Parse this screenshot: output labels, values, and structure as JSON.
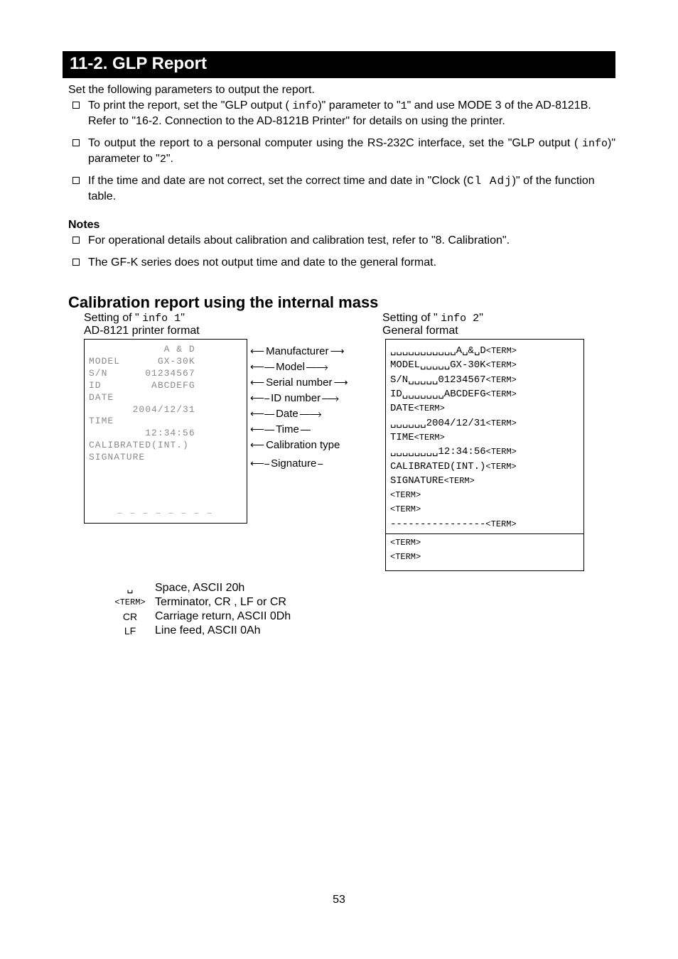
{
  "section": {
    "title": "11-2. GLP Report"
  },
  "intro": "Set the following parameters to output the report.",
  "bullets_a": [
    {
      "pre": "To print the report, set the \"GLP output ( ",
      "seg1": "info",
      "mid1": ")\" parameter to \"",
      "seg2": "1",
      "post": "\" and use MODE 3 of the AD-8121B. Refer to \"16-2. Connection to the AD-8121B Printer\" for details on using the printer."
    },
    {
      "pre": "To output the report to a personal computer using the RS-232C interface, set the \"GLP output ( ",
      "seg1": "info",
      "mid1": ")\" parameter to \"",
      "seg2": "2",
      "post": "\"."
    },
    {
      "pre": "If the time and date are not correct, set the correct time and date in \"Clock (",
      "seg1": "Cl Adj",
      "mid1": ")\" of the function table.",
      "seg2": "",
      "post": ""
    }
  ],
  "notes_heading": "Notes",
  "bullets_b": [
    "For operational details about calibration and calibration test, refer to \"8. Calibration\".",
    "The GF-K series does not output time and date to the general format."
  ],
  "cal_heading": "Calibration report using the internal mass",
  "col_headings": {
    "left_setting_pre": "Setting of \" ",
    "left_setting_seg": "info  1",
    "left_setting_post": "\"",
    "left_sub": "AD-8121 printer format",
    "right_setting_pre": "Setting of \" ",
    "right_setting_seg": "info  2",
    "right_setting_post": "\"",
    "right_sub": "General format"
  },
  "left_panel_lines": [
    "            A & D",
    "MODEL      GX-30K",
    "S/N      01234567",
    "ID        ABCDEFG",
    "DATE",
    "       2004/12/31",
    "TIME",
    "         12:34:56",
    "CALIBRATED(INT.)",
    "SIGNATURE",
    "",
    ""
  ],
  "middle_labels": {
    "manufacturer": "Manufacturer",
    "model": "Model",
    "serial": "Serial number",
    "id": "ID number",
    "date": "Date",
    "time": "Time",
    "caltype": "Calibration type",
    "signature": "Signature"
  },
  "right_panel": {
    "l1": {
      "pre": "␣␣␣␣␣␣␣␣␣␣␣A␣&␣D",
      "term": "<TERM>"
    },
    "l2": {
      "pre": "MODEL␣␣␣␣␣GX-30K",
      "term": "<TERM>"
    },
    "l3": {
      "pre": "S/N␣␣␣␣␣01234567",
      "term": "<TERM>"
    },
    "l4": {
      "pre": "ID␣␣␣␣␣␣␣ABCDEFG",
      "term": "<TERM>"
    },
    "l5": {
      "pre": "DATE",
      "term": "<TERM>"
    },
    "l6": {
      "pre": "␣␣␣␣␣␣2004/12/31",
      "term": "<TERM>"
    },
    "l7": {
      "pre": "TIME",
      "term": "<TERM>"
    },
    "l8": {
      "pre": "␣␣␣␣␣␣␣␣12:34:56",
      "term": "<TERM>"
    },
    "l9": {
      "pre": "CALIBRATED(INT.)",
      "term": "<TERM>"
    },
    "l10": {
      "pre": "SIGNATURE",
      "term": "<TERM>"
    },
    "l11": {
      "pre": "",
      "term": "<TERM>"
    },
    "l12": {
      "pre": "",
      "term": "<TERM>"
    },
    "l13": {
      "pre": "----------------",
      "term": "<TERM>"
    },
    "l14": {
      "pre": "",
      "term": "<TERM>"
    },
    "l15": {
      "pre": "",
      "term": "<TERM>"
    }
  },
  "legend": {
    "space_sym": "␣",
    "space_txt": "Space, ASCII 20h",
    "term_sym": "<TERM>",
    "term_txt": "Terminator, CR , LF or CR",
    "cr_sym": "CR",
    "cr_txt": "Carriage return, ASCII 0Dh",
    "lf_sym": "LF",
    "lf_txt": "Line feed, ASCII 0Ah"
  },
  "page_number": "53"
}
